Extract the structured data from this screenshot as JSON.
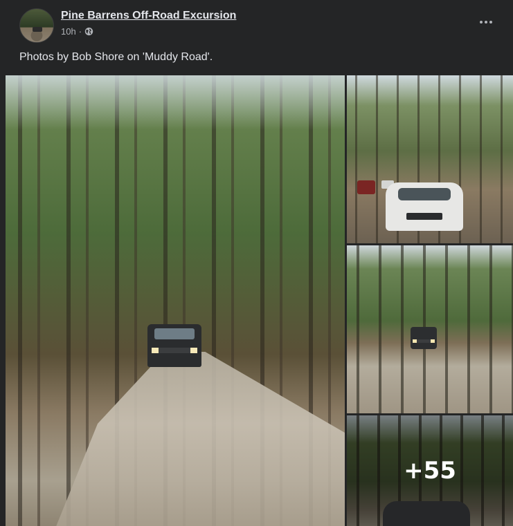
{
  "post": {
    "group_name": "Pine Barrens Off-Road Excursion",
    "time": "10h",
    "separator": "·",
    "privacy_icon": "globe-icon",
    "more_icon": "more-options-icon",
    "caption": "Photos by Bob Shore on 'Muddy Road'."
  },
  "photos": {
    "more_count": "+55",
    "items": [
      {
        "name": "photo-main",
        "description_icon": "photo"
      },
      {
        "name": "photo-top-right",
        "description_icon": "photo"
      },
      {
        "name": "photo-middle-right",
        "description_icon": "photo"
      },
      {
        "name": "photo-bottom-right",
        "description_icon": "photo"
      }
    ]
  },
  "colors": {
    "background": "#242526",
    "text_primary": "#e4e6eb",
    "text_secondary": "#b0b3b8"
  }
}
